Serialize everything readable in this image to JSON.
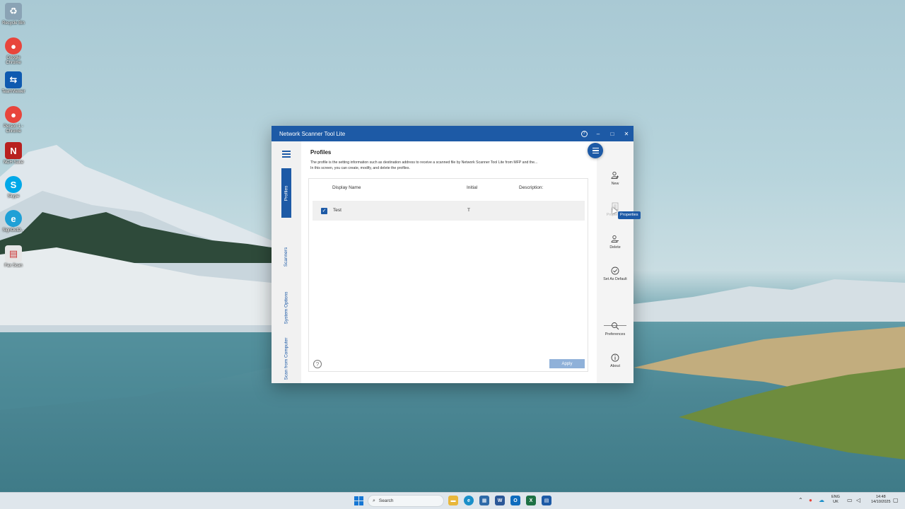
{
  "desktop": {
    "icons": [
      {
        "name": "Recycle Bin",
        "glyph": "♻",
        "color": "#8aa3b5"
      },
      {
        "name": "Google Chrome",
        "glyph": "●",
        "color": "#e8453c"
      },
      {
        "name": "TeamViewer",
        "glyph": "⇆",
        "color": "#0e5ab0"
      },
      {
        "name": "Person 1 - Chrome",
        "glyph": "●",
        "color": "#e8453c"
      },
      {
        "name": "NCH Suite",
        "glyph": "N",
        "color": "#b8201f"
      },
      {
        "name": "Skype",
        "glyph": "S",
        "color": "#00a8e8"
      },
      {
        "name": "SignOutD...",
        "glyph": "e",
        "color": "#1fa0d6"
      },
      {
        "name": "Fax Scan",
        "glyph": "▤",
        "color": "#d9d9d9"
      }
    ]
  },
  "window": {
    "title": "Network Scanner Tool Lite",
    "help_glyph": "?",
    "minimize_glyph": "–",
    "maximize_glyph": "□",
    "close_glyph": "✕"
  },
  "nav": {
    "tabs": [
      {
        "label": "Profiles",
        "active": true
      },
      {
        "label": "Scanners",
        "active": false
      },
      {
        "label": "System Options",
        "active": false
      },
      {
        "label": "Scan from Computer",
        "active": false
      }
    ]
  },
  "profiles": {
    "title": "Profiles",
    "description_line1": "The profile is the setting information such as destination address to receive a scanned file by Network Scanner Tool Lite from MFP and the...",
    "description_line2": "In this screen, you can create, modify, and delete the profiles.",
    "columns": {
      "display_name": "Display Name",
      "initial": "Initial",
      "description": "Description:"
    },
    "rows": [
      {
        "checked": true,
        "display_name": "Test",
        "initial": "T",
        "description": ""
      }
    ],
    "apply_label": "Apply",
    "help_glyph": "?"
  },
  "actions": {
    "new_label": "New",
    "properties_label": "Properties",
    "delete_label": "Delete",
    "set_default_label": "Set As Default",
    "preferences_label": "Preferences",
    "about_label": "About",
    "tooltip": "Properties"
  },
  "taskbar": {
    "search_placeholder": "Search",
    "language_line1": "ENG",
    "language_line2": "UK",
    "time": "14:48",
    "date": "14/10/2025"
  },
  "colors": {
    "accent": "#1d5aa6",
    "apply_disabled": "#8fb1d9"
  }
}
